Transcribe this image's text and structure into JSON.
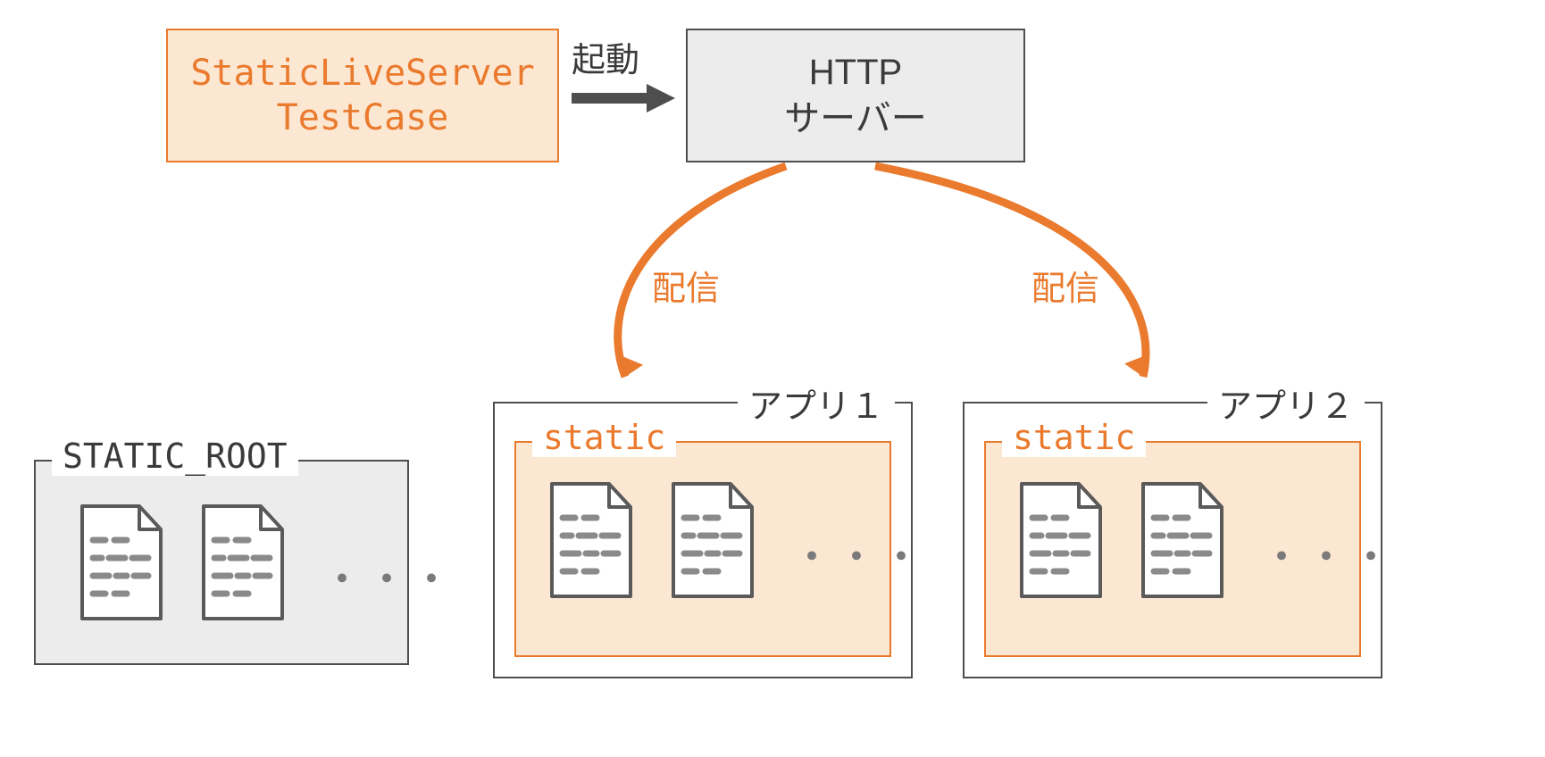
{
  "testcase": {
    "line1": "StaticLiveServer",
    "line2": "TestCase"
  },
  "server": {
    "line1": "HTTP",
    "line2": "サーバー"
  },
  "labels": {
    "launch": "起動",
    "deliver": "配信"
  },
  "static_root": {
    "legend": "STATIC_ROOT",
    "ellipsis": "・・・"
  },
  "apps": {
    "app1": {
      "legend": "アプリ１",
      "static_legend": "static",
      "ellipsis": "・・・"
    },
    "app2": {
      "legend": "アプリ２",
      "static_legend": "static",
      "ellipsis": "・・・"
    }
  },
  "colors": {
    "orange": "#EA7A2D",
    "orange_fill": "#FCE7D2",
    "gray_fill": "#ECECEC",
    "border": "#4E4E4E"
  }
}
